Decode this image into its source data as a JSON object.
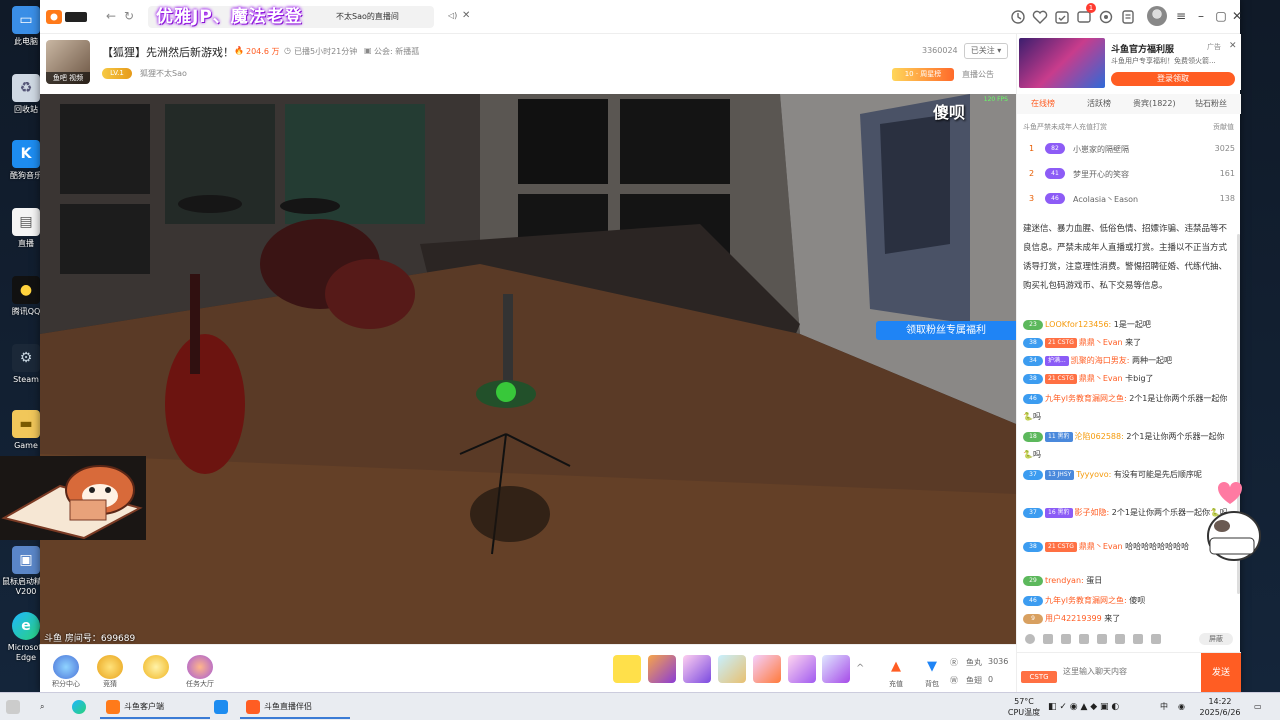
{
  "colors": {
    "accent": "#ff5d23",
    "blue": "#1f84f5",
    "purple_banner": "#a020f0"
  },
  "desktop": {
    "icons": [
      {
        "label": "此电脑",
        "icon": "computer-icon"
      },
      {
        "label": "回收站",
        "icon": "recycle-bin-icon"
      },
      {
        "label": "酷狗音乐",
        "icon": "kugou-icon"
      },
      {
        "label": "直播",
        "icon": "file-icon"
      },
      {
        "label": "腾讯QQ",
        "icon": "qq-icon"
      },
      {
        "label": "Steam",
        "icon": "steam-icon"
      },
      {
        "label": "Game",
        "icon": "folder-icon"
      },
      {
        "label": "鼠标启动精灵V200",
        "icon": "app-icon"
      },
      {
        "label": "Microsoft Edge",
        "icon": "edge-icon"
      }
    ]
  },
  "titlebar": {
    "banner": "优雅JP、魔法老登",
    "tab_title": "不太Sao的直播间",
    "notification_count": "1"
  },
  "room": {
    "title": "【狐狸】先洲然后新游戏！",
    "heat": "204.6 万",
    "live_duration": "已播5小时21分钟",
    "guild": "公会: 新播孤",
    "streamer_level": "LV.1",
    "streamer_name": "狐狸不太Sao",
    "avatar_tag": "鱼吧  视频",
    "room_id": "3360024",
    "follow_label": "已关注 ▾",
    "gift_rank": "10 · 周星榜",
    "announcement": "直播公告"
  },
  "video": {
    "overlay_text": "傻呗",
    "fps": "120 FPS",
    "fan_benefit": "领取粉丝专属福利",
    "room_number": "斗鱼 房间号：699689"
  },
  "toolbar": {
    "tools": [
      {
        "label": "积分中心",
        "icon": "points-icon"
      },
      {
        "label": "竞猜",
        "icon": "trophy-icon"
      },
      {
        "label": "",
        "icon": "egg-icon"
      },
      {
        "label": "任务大厅",
        "icon": "task-hall-icon"
      }
    ],
    "recharge": "充值",
    "backpack": "背包",
    "fish_balls_label": "鱼丸",
    "fish_balls": "3036",
    "fish_wings_label": "鱼翅",
    "fish_wings": "0"
  },
  "ad": {
    "title": "斗鱼官方福利服",
    "subtitle": "斗鱼用户专享福利！免费领火箭...",
    "button": "登录领取",
    "label": "广告"
  },
  "rank_tabs": [
    "在线榜",
    "活跃榜",
    "贵宾(1822)",
    "钻石粉丝"
  ],
  "rank_notice": "斗鱼严禁未成年人充值打赏",
  "rank_contrib": "贡献值",
  "ranking": [
    {
      "num": "1",
      "level": "82",
      "name": "小崽家的隔壁隔",
      "score": "3025"
    },
    {
      "num": "2",
      "level": "41",
      "name": "梦里开心的笑容",
      "score": "161"
    },
    {
      "num": "3",
      "level": "46",
      "name": "Acolasia丶Eason",
      "score": "138"
    }
  ],
  "chat": {
    "system_notice": "建迷信、暴力血腥、低俗色情、招嫖诈骗、违禁品等不良信息。严禁未成年人直播或打赏。主播以不正当方式诱导打赏，注意理性消费。警惕招聘征婚、代练代抽、购买礼包码游戏币、私下交易等信息。",
    "messages": [
      {
        "level": "23",
        "fan": "",
        "user": "LOOKfor123456:",
        "text": " 1是一起吧"
      },
      {
        "level": "38",
        "fan": "21 CSTG",
        "user": "鼎鼎丶Evan",
        "text": " 来了"
      },
      {
        "level": "34",
        "fan": "护满...",
        "user": "凯聚的海口男友:",
        "text": " 两种一起吧"
      },
      {
        "level": "38",
        "fan": "21 CSTG",
        "user": "鼎鼎丶Evan",
        "text": " 卡big了"
      },
      {
        "level": "46",
        "fan": "",
        "user": "九年yl务教育漏网之鱼:",
        "text": " 2个1是让你两个乐器一起你🐍吗"
      },
      {
        "level": "18",
        "fan": "11 黑豹",
        "user": "沦陷062588:",
        "text": " 2个1是让你两个乐器一起你🐍吗"
      },
      {
        "level": "37",
        "fan": "13 JHSY",
        "user": "Tyyyovo:",
        "text": " 有没有可能是先后顺序呢"
      },
      {
        "level": "37",
        "fan": "16 黑豹",
        "user": "影子如隐:",
        "text": " 2个1是让你两个乐器一起你🐍吗"
      },
      {
        "level": "38",
        "fan": "21 CSTG",
        "user": "鼎鼎丶Evan",
        "text": " 哈哈哈哈哈哈哈哈"
      },
      {
        "level": "29",
        "fan": "",
        "user": "trendyan:",
        "text": " 蛋日"
      },
      {
        "level": "46",
        "fan": "",
        "user": "九年yl务教育漏网之鱼:",
        "text": " 傻呗"
      },
      {
        "level": "9",
        "fan": "",
        "user": "用户42219399",
        "text": " 来了"
      }
    ],
    "input_placeholder": "这里输入聊天内容",
    "send": "发送",
    "badge": "CSTG",
    "hide_label": "屏蔽"
  },
  "taskbar": {
    "apps": [
      {
        "label": "斗鱼客户端"
      },
      {
        "label": ""
      },
      {
        "label": "斗鱼直播伴侣"
      }
    ],
    "weather_temp": "57°C",
    "weather_label": "CPU温度",
    "time": "14:22",
    "date": "2025/6/26",
    "ime": "中"
  }
}
